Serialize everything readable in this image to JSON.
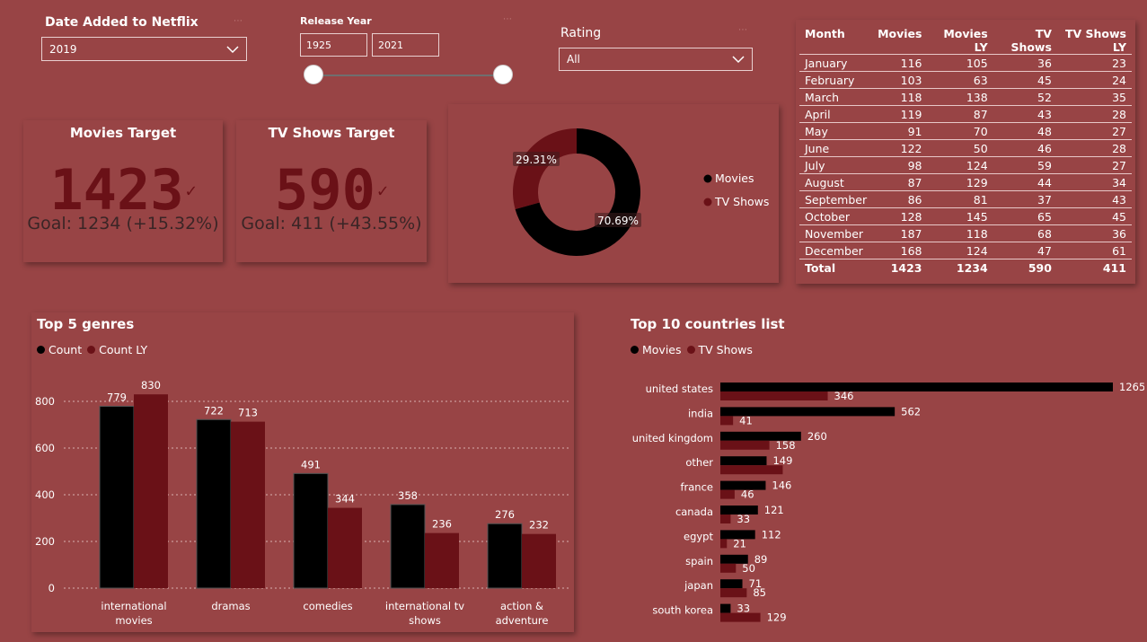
{
  "colors": {
    "background": "#984445",
    "movies": "#000000",
    "tv_shows": "#6a1117",
    "accent_dark": "#6a1117"
  },
  "date_slicer": {
    "title": "Date Added to Netflix",
    "selected": "2019"
  },
  "release_slicer": {
    "title": "Release Year",
    "from": "1925",
    "to": "2021"
  },
  "rating_slicer": {
    "title": "Rating",
    "selected": "All"
  },
  "kpi_movies": {
    "title": "Movies Target",
    "value": "1423",
    "goal": "Goal: 1234 (+15.32%)"
  },
  "kpi_tv": {
    "title": "TV Shows Target",
    "value": "590",
    "goal": "Goal: 411 (+43.55%)"
  },
  "donut": {
    "legend": [
      "Movies",
      "TV Shows"
    ],
    "label_movies": "70.69%",
    "label_tv": "29.31%"
  },
  "month_table": {
    "headers": [
      "Month",
      "Movies",
      "Movies LY",
      "TV Shows",
      "TV Shows LY"
    ],
    "rows": [
      [
        "January",
        "116",
        "105",
        "36",
        "23"
      ],
      [
        "February",
        "103",
        "63",
        "45",
        "24"
      ],
      [
        "March",
        "118",
        "138",
        "52",
        "35"
      ],
      [
        "April",
        "119",
        "87",
        "43",
        "28"
      ],
      [
        "May",
        "91",
        "70",
        "48",
        "27"
      ],
      [
        "June",
        "122",
        "50",
        "46",
        "28"
      ],
      [
        "July",
        "98",
        "124",
        "59",
        "27"
      ],
      [
        "August",
        "87",
        "129",
        "44",
        "34"
      ],
      [
        "September",
        "86",
        "81",
        "37",
        "43"
      ],
      [
        "October",
        "128",
        "145",
        "65",
        "45"
      ],
      [
        "November",
        "187",
        "118",
        "68",
        "36"
      ],
      [
        "December",
        "168",
        "124",
        "47",
        "61"
      ]
    ],
    "total": [
      "Total",
      "1423",
      "1234",
      "590",
      "411"
    ]
  },
  "genres_card": {
    "title": "Top 5 genres",
    "legend": [
      "Count",
      "Count LY"
    ]
  },
  "countries_card": {
    "title": "Top 10 countries list",
    "legend": [
      "Movies",
      "TV Shows"
    ]
  },
  "chart_data": [
    {
      "type": "pie",
      "categories": [
        "Movies",
        "TV Shows"
      ],
      "values": [
        70.69,
        29.31
      ],
      "labels": [
        "70.69%",
        "29.31%"
      ]
    },
    {
      "type": "bar",
      "title": "Top 5 genres",
      "categories": [
        "international movies",
        "dramas",
        "comedies",
        "international tv shows",
        "action & adventure"
      ],
      "category_lines": [
        [
          "international",
          "movies"
        ],
        [
          "dramas"
        ],
        [
          "comedies"
        ],
        [
          "international tv",
          "shows"
        ],
        [
          "action &",
          "adventure"
        ]
      ],
      "series": [
        {
          "name": "Count",
          "values": [
            779,
            722,
            491,
            358,
            276
          ]
        },
        {
          "name": "Count LY",
          "values": [
            830,
            713,
            344,
            236,
            232
          ]
        }
      ],
      "ylim": [
        0,
        800
      ],
      "yticks": [
        0,
        200,
        400,
        600,
        800
      ],
      "grid": true,
      "legend": "top-left"
    },
    {
      "type": "bar",
      "orientation": "horizontal",
      "title": "Top 10 countries list",
      "categories": [
        "united states",
        "india",
        "united kingdom",
        "other",
        "france",
        "canada",
        "egypt",
        "spain",
        "japan",
        "south korea"
      ],
      "series": [
        {
          "name": "Movies",
          "values": [
            1265,
            562,
            260,
            149,
            146,
            121,
            112,
            89,
            71,
            33
          ]
        },
        {
          "name": "TV Shows",
          "values": [
            346,
            41,
            158,
            201,
            46,
            33,
            21,
            50,
            85,
            129
          ]
        }
      ],
      "hidden_labels": [
        [
          "TV Shows",
          "other"
        ]
      ],
      "legend": "top-left"
    }
  ]
}
